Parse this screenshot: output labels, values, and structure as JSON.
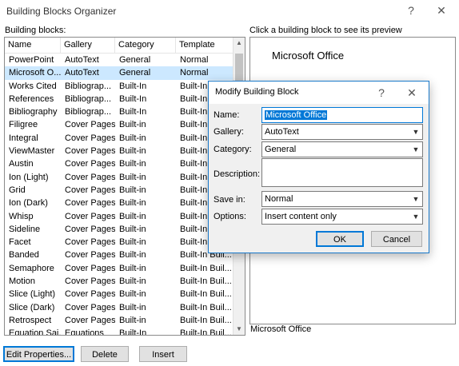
{
  "window": {
    "title": "Building Blocks Organizer",
    "help": "?",
    "close": "✕"
  },
  "left_label": "Building blocks:",
  "preview_label": "Click a building block to see its preview",
  "preview_text": "Microsoft Office",
  "preview_caption": "Microsoft Office",
  "columns": [
    "Name",
    "Gallery",
    "Category",
    "Template"
  ],
  "rows": [
    [
      "PowerPoint",
      "AutoText",
      "General",
      "Normal"
    ],
    [
      "Microsoft O...",
      "AutoText",
      "General",
      "Normal"
    ],
    [
      "Works Cited",
      "Bibliograp...",
      "Built-In",
      "Built-In"
    ],
    [
      "References",
      "Bibliograp...",
      "Built-In",
      "Built-In"
    ],
    [
      "Bibliography",
      "Bibliograp...",
      "Built-In",
      "Built-In"
    ],
    [
      "Filigree",
      "Cover Pages",
      "Built-in",
      "Built-In"
    ],
    [
      "Integral",
      "Cover Pages",
      "Built-in",
      "Built-In"
    ],
    [
      "ViewMaster",
      "Cover Pages",
      "Built-in",
      "Built-In"
    ],
    [
      "Austin",
      "Cover Pages",
      "Built-in",
      "Built-In"
    ],
    [
      "Ion (Light)",
      "Cover Pages",
      "Built-in",
      "Built-In"
    ],
    [
      "Grid",
      "Cover Pages",
      "Built-in",
      "Built-In"
    ],
    [
      "Ion (Dark)",
      "Cover Pages",
      "Built-in",
      "Built-In"
    ],
    [
      "Whisp",
      "Cover Pages",
      "Built-in",
      "Built-In"
    ],
    [
      "Sideline",
      "Cover Pages",
      "Built-in",
      "Built-In"
    ],
    [
      "Facet",
      "Cover Pages",
      "Built-in",
      "Built-In"
    ],
    [
      "Banded",
      "Cover Pages",
      "Built-in",
      "Built-In Buil..."
    ],
    [
      "Semaphore",
      "Cover Pages",
      "Built-in",
      "Built-In Buil..."
    ],
    [
      "Motion",
      "Cover Pages",
      "Built-in",
      "Built-In Buil..."
    ],
    [
      "Slice (Light)",
      "Cover Pages",
      "Built-in",
      "Built-In Buil..."
    ],
    [
      "Slice (Dark)",
      "Cover Pages",
      "Built-in",
      "Built-In Buil..."
    ],
    [
      "Retrospect",
      "Cover Pages",
      "Built-in",
      "Built-In Buil..."
    ],
    [
      "Equation Sai...",
      "Equations",
      "Built-In",
      "Built-In Buil..."
    ]
  ],
  "selected_row": 1,
  "buttons": {
    "edit": "Edit Properties...",
    "delete": "Delete",
    "insert": "Insert"
  },
  "dialog": {
    "title": "Modify Building Block",
    "help": "?",
    "close": "✕",
    "name_label": "Name:",
    "name_value": "Microsoft Office",
    "gallery_label": "Gallery:",
    "gallery_value": "AutoText",
    "category_label": "Category:",
    "category_value": "General",
    "description_label": "Description:",
    "description_value": "",
    "savein_label": "Save in:",
    "savein_value": "Normal",
    "options_label": "Options:",
    "options_value": "Insert content only",
    "ok": "OK",
    "cancel": "Cancel"
  },
  "colors": {
    "selection": "#cce8ff",
    "dialog_border": "#1979ca",
    "accent": "#0078d7"
  }
}
